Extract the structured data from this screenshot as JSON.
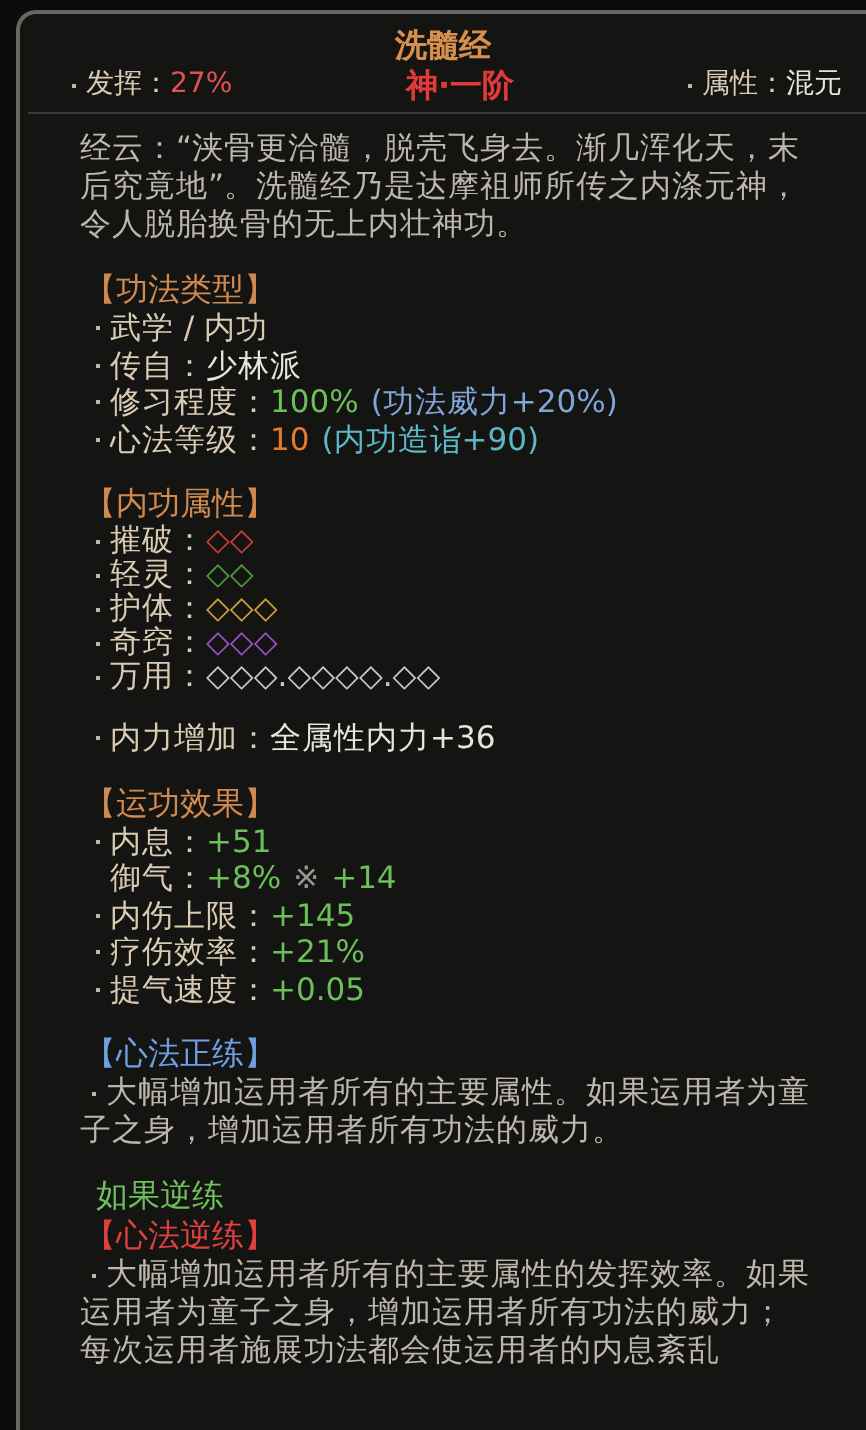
{
  "header": {
    "title": "洗髓经",
    "tier": "神·一阶",
    "stats": [
      {
        "label": "发挥：",
        "value": "27%",
        "color": "#e25252"
      },
      {
        "label": "属性：",
        "value": "混元",
        "color": "#e8e4dc"
      }
    ]
  },
  "description": "经云：“浃骨更洽髓，脱壳飞身去。渐几浑化天，末后究竟地”。洗髓经乃是达摩祖师所传之内涤元神，令人脱胎换骨的无上内壮神功。",
  "blocks": [
    {
      "kind": "list",
      "heading": "【功法类型】",
      "color": "#d08a50",
      "lines": [
        {
          "label": "武学 / 内功",
          "bullet": true
        },
        {
          "label": "传自：",
          "bullet": true,
          "values": [
            {
              "text": "少林派",
              "color": "#e8e4dc"
            }
          ]
        },
        {
          "label": "修习程度：",
          "bullet": true,
          "values": [
            {
              "text": "100%",
              "color": "#6cbf5a"
            },
            {
              "text": "(功法威力+20%)",
              "color": "#7fa6d6"
            }
          ]
        },
        {
          "label": "心法等级：",
          "bullet": true,
          "values": [
            {
              "text": "10",
              "color": "#e37b2e"
            },
            {
              "text": "(内功造诣+90)",
              "color": "#5cb8c6"
            }
          ]
        }
      ]
    },
    {
      "kind": "list",
      "heading": "【内功属性】",
      "color": "#d08a50",
      "lines": [
        {
          "label": "摧破：",
          "bullet": true,
          "values": [
            {
              "text": "◇◇",
              "color": "#c83c3c"
            }
          ]
        },
        {
          "label": "轻灵：",
          "bullet": true,
          "values": [
            {
              "text": "◇◇",
              "color": "#4f9a3e"
            }
          ]
        },
        {
          "label": "护体：",
          "bullet": true,
          "values": [
            {
              "text": "◇◇◇",
              "color": "#c8a23a"
            }
          ]
        },
        {
          "label": "奇窍：",
          "bullet": true,
          "values": [
            {
              "text": "◇◇◇",
              "color": "#9a4fc8"
            }
          ]
        },
        {
          "label": "万用：",
          "bullet": true,
          "values": [
            {
              "text": "◇◇◇.◇◇◇◇.◇◇",
              "color": "#c8c8c8"
            }
          ]
        }
      ]
    },
    {
      "kind": "list",
      "lines": [
        {
          "label": "内力增加：",
          "bullet": true,
          "values": [
            {
              "text": "全属性内力+36",
              "color": "#e8e4dc"
            }
          ]
        }
      ]
    },
    {
      "kind": "list",
      "heading": "【运功效果】",
      "color": "#d08a50",
      "lines": [
        {
          "label": "内息：",
          "bullet": true,
          "values": [
            {
              "text": "+51",
              "color": "#6cbf5a"
            }
          ]
        },
        {
          "label": "御气：",
          "bullet": false,
          "values": [
            {
              "text": "+8%",
              "color": "#6cbf5a"
            },
            {
              "text": "※",
              "color": "#9a9590"
            },
            {
              "text": "+14",
              "color": "#6cbf5a"
            }
          ]
        },
        {
          "label": "内伤上限：",
          "bullet": true,
          "values": [
            {
              "text": "+145",
              "color": "#6cbf5a"
            }
          ]
        },
        {
          "label": "疗伤效率：",
          "bullet": true,
          "values": [
            {
              "text": "+21%",
              "color": "#6cbf5a"
            }
          ]
        },
        {
          "label": "提气速度：",
          "bullet": true,
          "values": [
            {
              "text": "+0.05",
              "color": "#6cbf5a"
            }
          ]
        }
      ]
    },
    {
      "kind": "paragraph",
      "heading": "【心法正练】",
      "color": "#6f9fe0",
      "paragraphs": [
        {
          "text": "大幅增加运用者所有的主要属性。如果运用者为童子之身，增加运用者所有功法的威力。",
          "bullet": true
        }
      ]
    },
    {
      "kind": "paragraph",
      "note": "如果逆练",
      "heading": "【心法逆练】",
      "color": "#e04040",
      "paragraphs": [
        {
          "text": "大幅增加运用者所有的主要属性的发挥效率。如果运用者为童子之身，增加运用者所有功法的威力；",
          "bullet": true
        },
        {
          "text": "每次运用者施展功法都会使运用者的内息紊乱",
          "bullet": false
        }
      ]
    }
  ]
}
